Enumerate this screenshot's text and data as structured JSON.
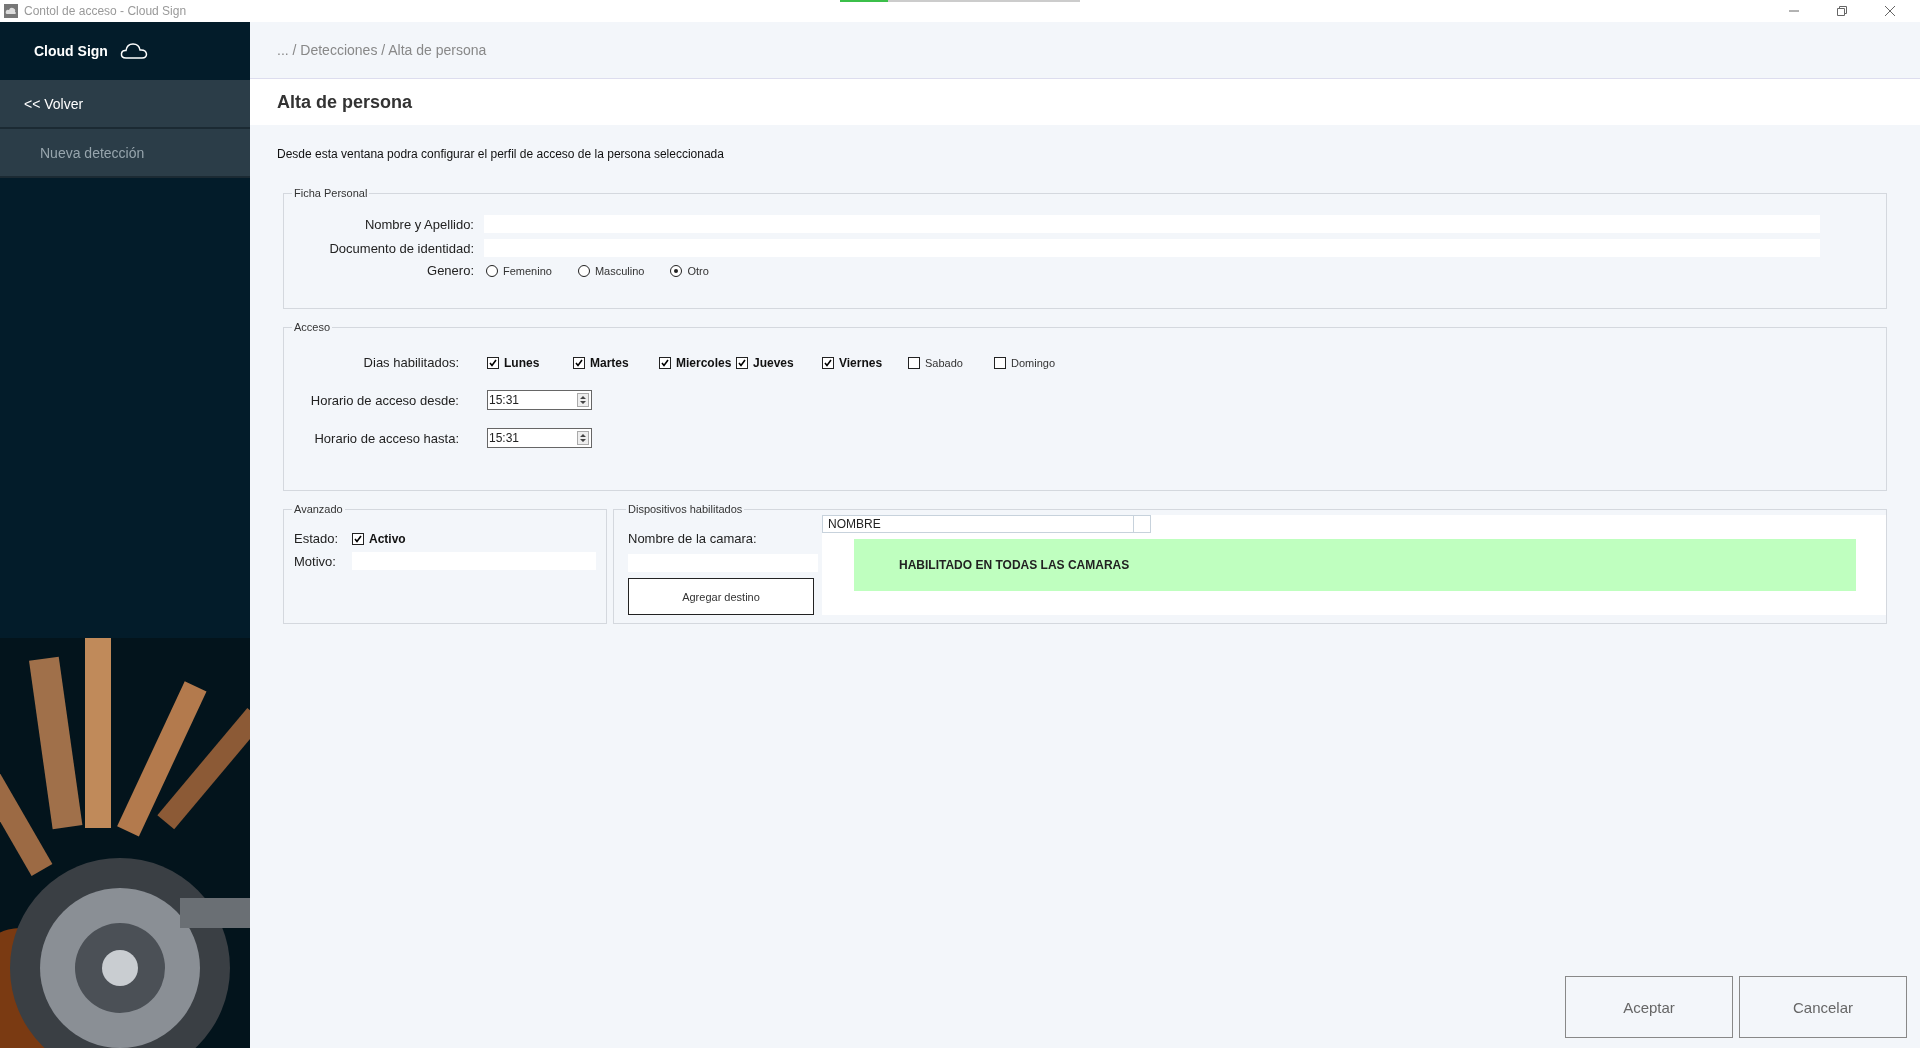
{
  "window": {
    "title": "Contol de acceso - Cloud Sign"
  },
  "progress": {
    "level": 0.2
  },
  "sidebar": {
    "brand": "Cloud Sign",
    "items": [
      {
        "label": "<< Volver",
        "kind": "back"
      },
      {
        "label": "Nueva detección",
        "kind": "item"
      }
    ]
  },
  "breadcrumb": "... / Detecciones / Alta de persona",
  "page_title": "Alta de persona",
  "description": "Desde esta ventana podra configurar el perfil de acceso de la persona seleccionada",
  "ficha": {
    "legend": "Ficha Personal",
    "fields": [
      {
        "label": "Nombre y Apellido:"
      },
      {
        "label": "Documento de identidad:"
      }
    ],
    "gender_label": "Genero:",
    "genders": [
      {
        "label": "Femenino",
        "selected": false
      },
      {
        "label": "Masculino",
        "selected": false
      },
      {
        "label": "Otro",
        "selected": true
      }
    ]
  },
  "acceso": {
    "legend": "Acceso",
    "days_label": "Dias habilitados:",
    "days": [
      {
        "label": "Lunes",
        "checked": true
      },
      {
        "label": "Martes",
        "checked": true
      },
      {
        "label": "Miercoles",
        "checked": true
      },
      {
        "label": "Jueves",
        "checked": true
      },
      {
        "label": "Viernes",
        "checked": true
      },
      {
        "label": "Sabado",
        "checked": false
      },
      {
        "label": "Domingo",
        "checked": false
      }
    ],
    "times": [
      {
        "label": "Horario de acceso desde:",
        "value": "15:31"
      },
      {
        "label": "Horario de acceso hasta:",
        "value": "15:31"
      }
    ]
  },
  "avanzado": {
    "legend": "Avanzado",
    "estado_label": "Estado:",
    "estado": {
      "label": "Activo",
      "checked": true
    },
    "motivo_label": "Motivo:"
  },
  "dispositivos": {
    "legend": "Dispositivos habilitados",
    "camera_label": "Nombre de la camara:",
    "add_button": "Agregar destino",
    "column": "NOMBRE",
    "banner": "HABILITADO EN TODAS LAS CAMARAS"
  },
  "buttons": [
    "Aceptar",
    "Cancelar"
  ]
}
